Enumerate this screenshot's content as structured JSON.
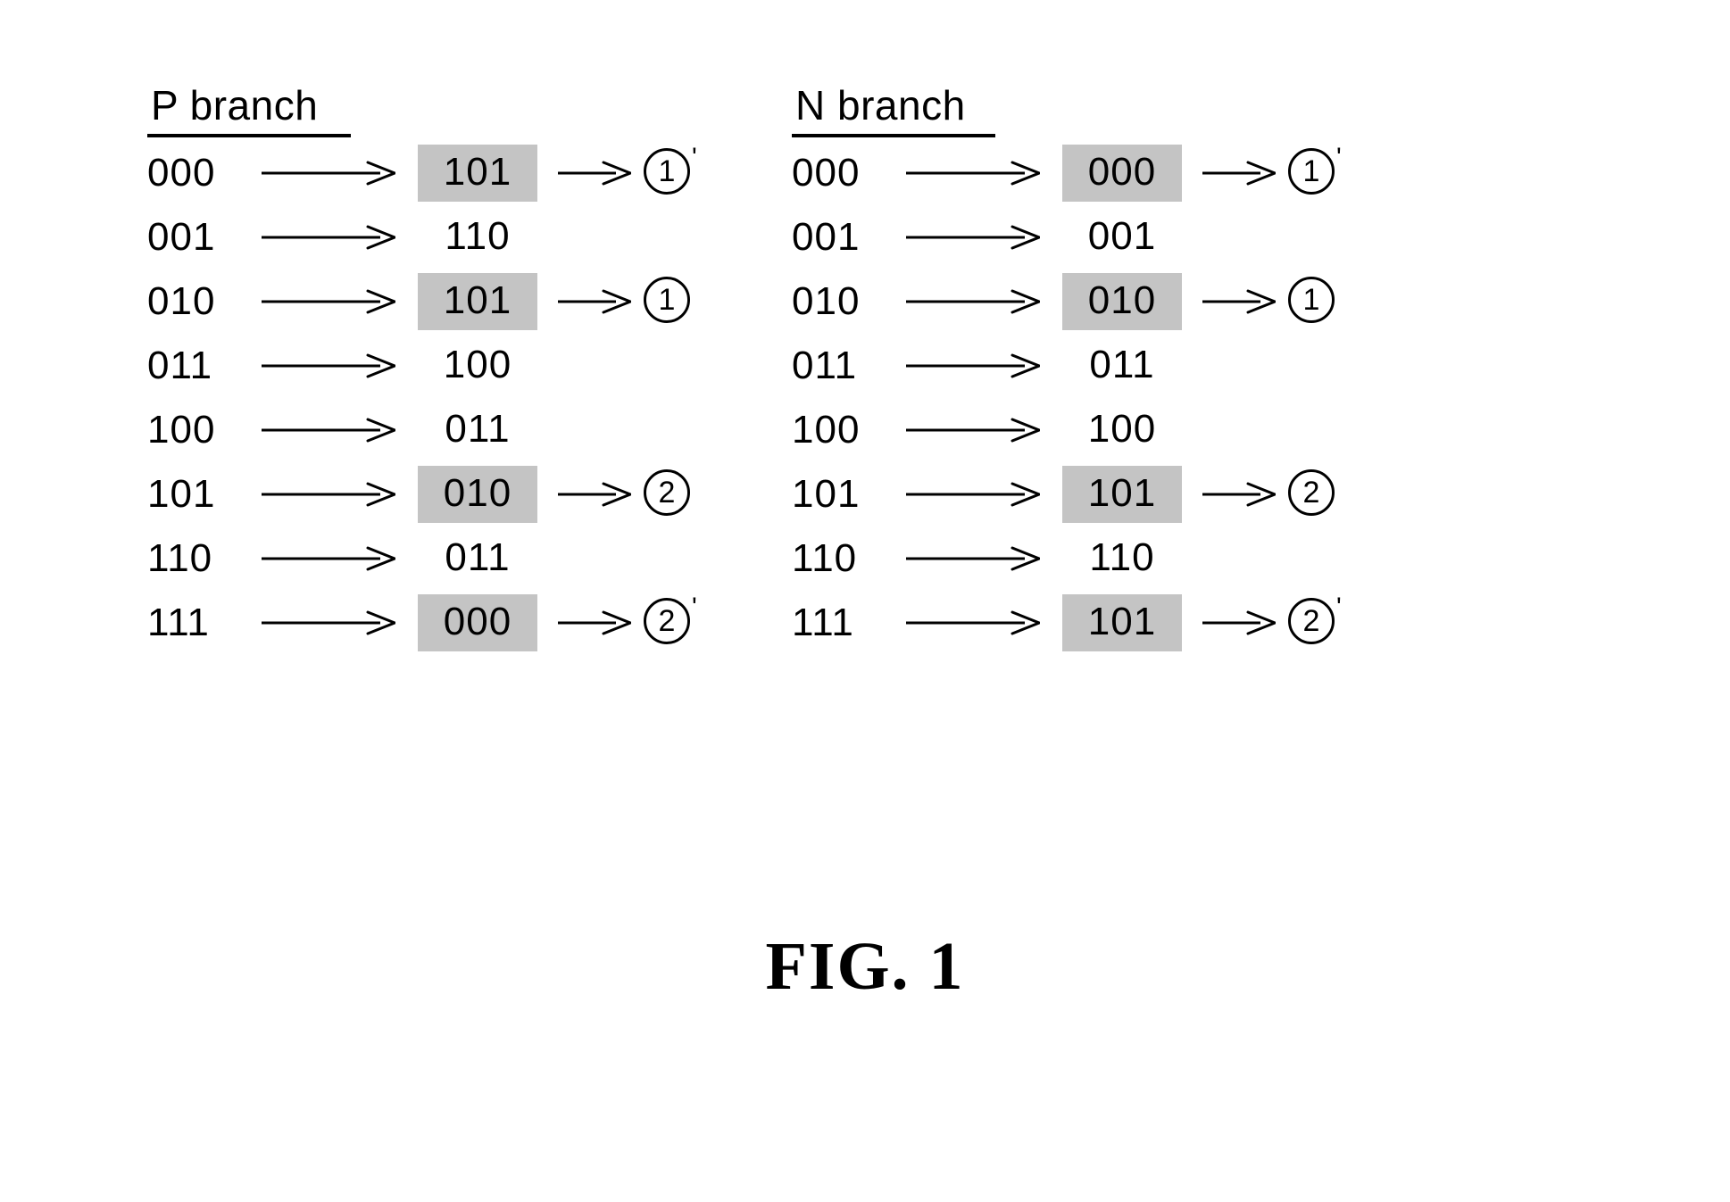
{
  "figure": {
    "caption": "FIG. 1",
    "highlight_color": "#c4c4c4",
    "ink_color": "#000000",
    "background_color": "#ffffff"
  },
  "branches": [
    {
      "id": "p-branch",
      "title": "P branch",
      "rows": [
        {
          "input": "000",
          "output": "101",
          "highlighted": true,
          "marker": "1",
          "prime": true
        },
        {
          "input": "001",
          "output": "110",
          "highlighted": false,
          "marker": "",
          "prime": false
        },
        {
          "input": "010",
          "output": "101",
          "highlighted": true,
          "marker": "1",
          "prime": false
        },
        {
          "input": "011",
          "output": "100",
          "highlighted": false,
          "marker": "",
          "prime": false
        },
        {
          "input": "100",
          "output": "011",
          "highlighted": false,
          "marker": "",
          "prime": false
        },
        {
          "input": "101",
          "output": "010",
          "highlighted": true,
          "marker": "2",
          "prime": false
        },
        {
          "input": "110",
          "output": "011",
          "highlighted": false,
          "marker": "",
          "prime": false
        },
        {
          "input": "111",
          "output": "000",
          "highlighted": true,
          "marker": "2",
          "prime": true
        }
      ]
    },
    {
      "id": "n-branch",
      "title": "N branch",
      "rows": [
        {
          "input": "000",
          "output": "000",
          "highlighted": true,
          "marker": "1",
          "prime": true
        },
        {
          "input": "001",
          "output": "001",
          "highlighted": false,
          "marker": "",
          "prime": false
        },
        {
          "input": "010",
          "output": "010",
          "highlighted": true,
          "marker": "1",
          "prime": false
        },
        {
          "input": "011",
          "output": "011",
          "highlighted": false,
          "marker": "",
          "prime": false
        },
        {
          "input": "100",
          "output": "100",
          "highlighted": false,
          "marker": "",
          "prime": false
        },
        {
          "input": "101",
          "output": "101",
          "highlighted": true,
          "marker": "2",
          "prime": false
        },
        {
          "input": "110",
          "output": "110",
          "highlighted": false,
          "marker": "",
          "prime": false
        },
        {
          "input": "111",
          "output": "101",
          "highlighted": true,
          "marker": "2",
          "prime": true
        }
      ]
    }
  ]
}
